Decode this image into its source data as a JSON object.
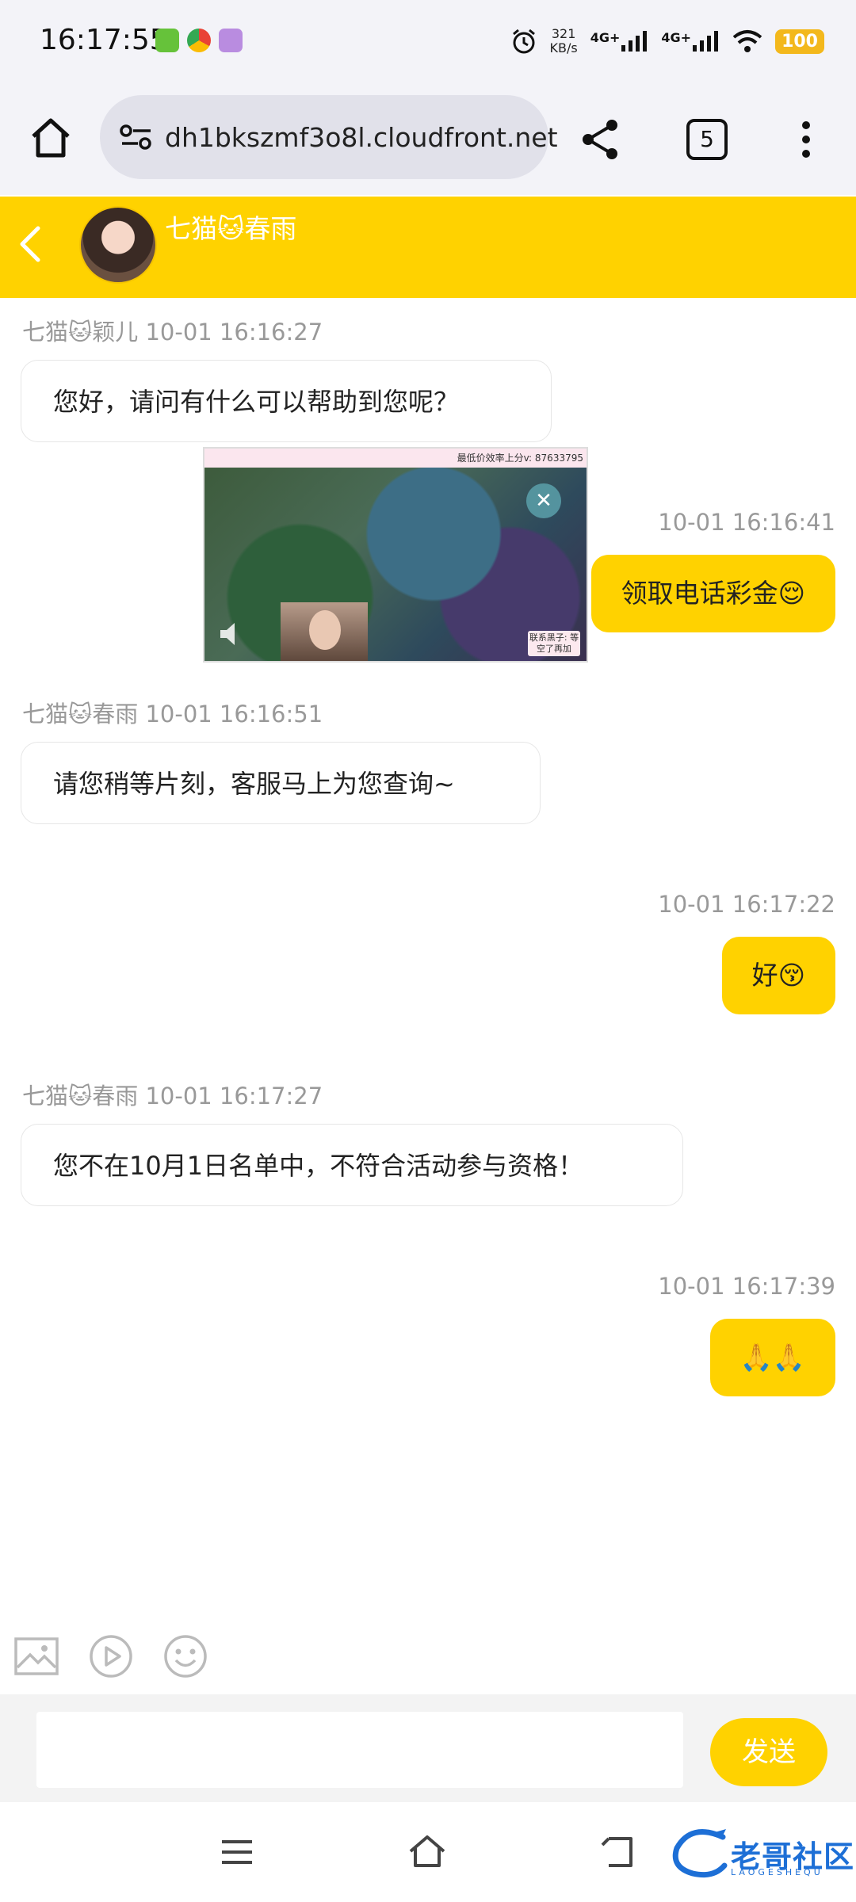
{
  "status_bar": {
    "time": "16:17:55",
    "speed_value": "321",
    "speed_unit": "KB/s",
    "net1": "4G+",
    "net2": "4G+",
    "battery": "100"
  },
  "browser": {
    "url": "dh1bkszmf3o8l.cloudfront.net",
    "tab_count": "5"
  },
  "chat": {
    "contact_name": "七猫🐱春雨",
    "messages": [
      {
        "side": "left",
        "timestamp": "七猫🐱颖儿 10-01 16:16:27",
        "text": "您好，请问有什么可以帮助到您呢？"
      },
      {
        "side": "right",
        "timestamp": "10-01 16:16:41",
        "text": "领取电话彩金😌"
      },
      {
        "side": "left",
        "timestamp": "七猫🐱春雨 10-01 16:16:51",
        "text": "请您稍等片刻，客服马上为您查询~"
      },
      {
        "side": "right",
        "timestamp": "10-01 16:17:22",
        "text": "好😚"
      },
      {
        "side": "left",
        "timestamp": "七猫🐱春雨 10-01 16:17:27",
        "text": "您不在10月1日名单中，不符合活动参与资格！"
      },
      {
        "side": "right",
        "timestamp": "10-01 16:17:39",
        "text": "🙏🙏"
      }
    ]
  },
  "video_overlay": {
    "banner_text": "最低价效率上分v: 87633795",
    "note": "联系黑子: 等空了再加"
  },
  "composer": {
    "placeholder": "",
    "send_label": "发送"
  },
  "watermark": {
    "text": "老哥社区",
    "sub": "LAOGESHEQU"
  },
  "colors": {
    "accent": "#ffd200",
    "battery": "#f3b81c",
    "watermark": "#1d6fd6"
  }
}
